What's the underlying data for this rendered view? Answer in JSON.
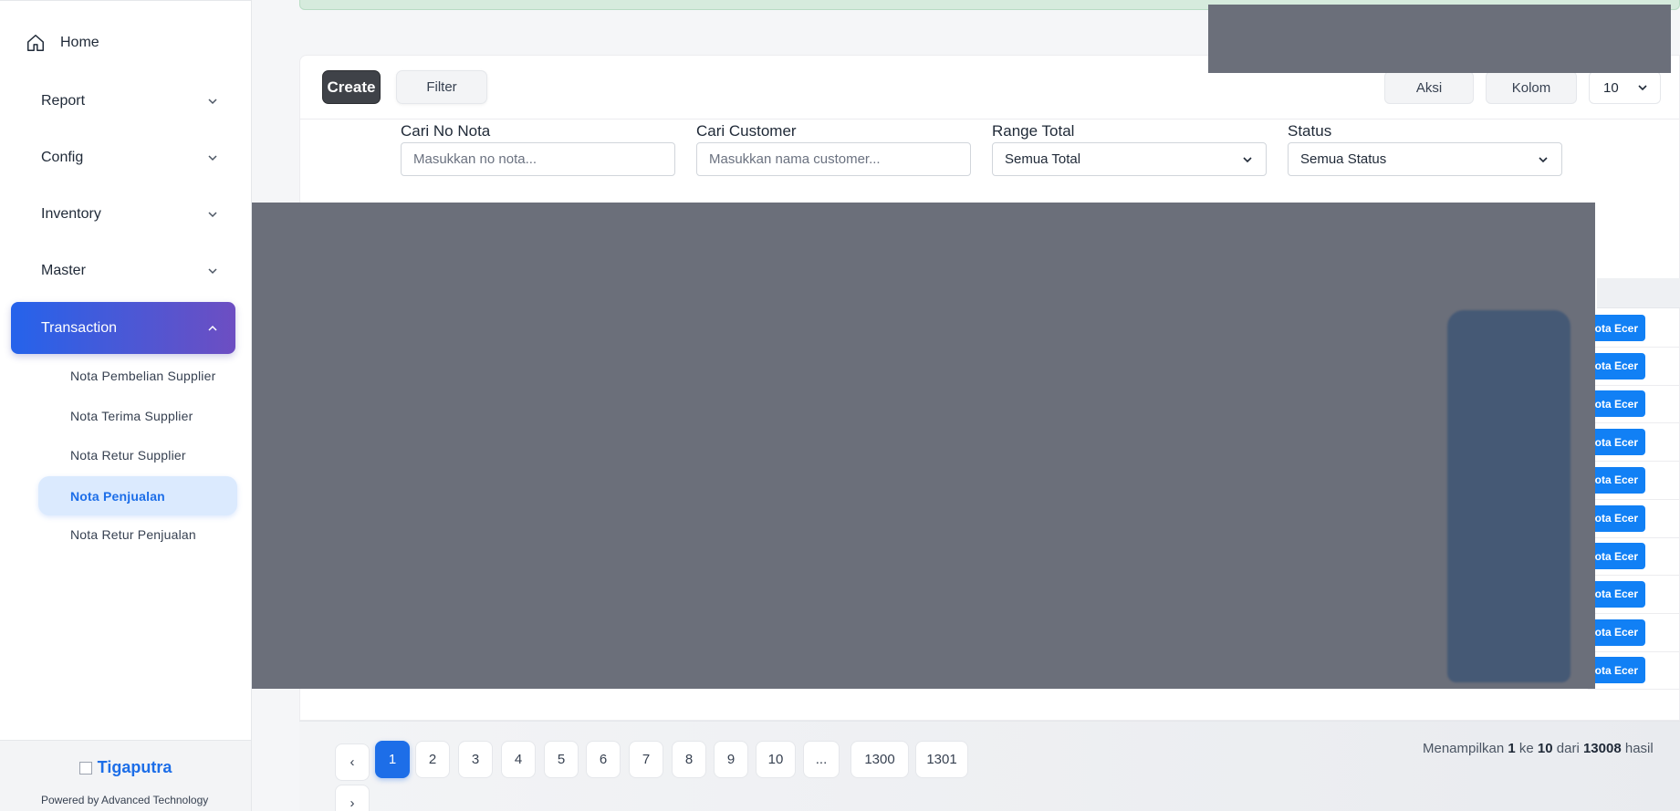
{
  "sidebar": {
    "home_label": "Home",
    "items": [
      {
        "label": "Report"
      },
      {
        "label": "Config"
      },
      {
        "label": "Inventory"
      },
      {
        "label": "Master"
      },
      {
        "label": "Transaction"
      }
    ],
    "sub_items": [
      {
        "label": "Nota Pembelian Supplier"
      },
      {
        "label": "Nota Terima Supplier"
      },
      {
        "label": "Nota Retur Supplier"
      },
      {
        "label": "Nota Penjualan"
      },
      {
        "label": "Nota Retur Penjualan"
      }
    ],
    "brand": "Tigaputra",
    "powered_by": "Powered by Advanced Technology"
  },
  "toolbar": {
    "create_label": "Create",
    "filter_label": "Filter",
    "aksi_label": "Aksi",
    "kolom_label": "Kolom",
    "per_page": "10"
  },
  "filters": {
    "nota": {
      "label": "Cari No Nota",
      "placeholder": "Masukkan no nota..."
    },
    "customer": {
      "label": "Cari Customer",
      "placeholder": "Masukkan nama customer..."
    },
    "range": {
      "label": "Range Total",
      "value": "Semua Total"
    },
    "status": {
      "label": "Status",
      "value": "Semua Status"
    }
  },
  "table": {
    "tags": [
      "Nota Ecer",
      "Nota Ecer",
      "Nota Ecer",
      "Nota Ecer",
      "Nota Ecer",
      "Nota Ecer",
      "Nota Ecer",
      "Nota Ecer",
      "Nota Ecer",
      "Nota Ecer"
    ]
  },
  "pagination": {
    "prev": "‹",
    "next": "›",
    "pages": [
      "1",
      "2",
      "3",
      "4",
      "5",
      "6",
      "7",
      "8",
      "9",
      "10",
      "...",
      "1300",
      "1301"
    ],
    "current": "1",
    "results_prefix": "Menampilkan",
    "from": "1",
    "ke": "ke",
    "to": "10",
    "dari": "dari",
    "total": "13008",
    "results_suffix": "hasil"
  },
  "colors": {
    "accent": "#1d6ee8",
    "tag": "#1180f5",
    "create_button": "#3f4248",
    "active_nav_start": "#2563eb",
    "active_nav_end": "#6d4ec2"
  }
}
